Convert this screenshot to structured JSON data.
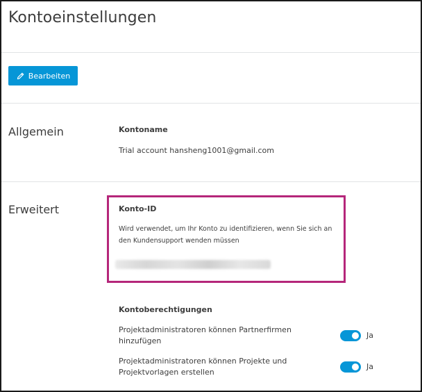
{
  "header": {
    "title": "Kontoeinstellungen"
  },
  "toolbar": {
    "edit_label": "Bearbeiten",
    "edit_icon": "pencil-icon",
    "accent": "#0696d7"
  },
  "general": {
    "section_title": "Allgemein",
    "account_name_label": "Kontoname",
    "account_name_value": "Trial account hansheng1001@gmail.com"
  },
  "advanced": {
    "section_title": "Erweitert",
    "account_id_label": "Konto-ID",
    "account_id_description": "Wird verwendet, um Ihr Konto zu identifizieren, wenn Sie sich an den Kundensupport wenden müssen",
    "highlight_color": "#b5267a",
    "permissions_label": "Kontoberechtigungen",
    "permissions": [
      {
        "text": "Projektadministratoren können Partnerfirmen hinzufügen",
        "state": "Ja",
        "enabled": true
      },
      {
        "text": "Projektadministratoren können Projekte und Projektvorlagen erstellen",
        "state": "Ja",
        "enabled": true
      }
    ]
  }
}
